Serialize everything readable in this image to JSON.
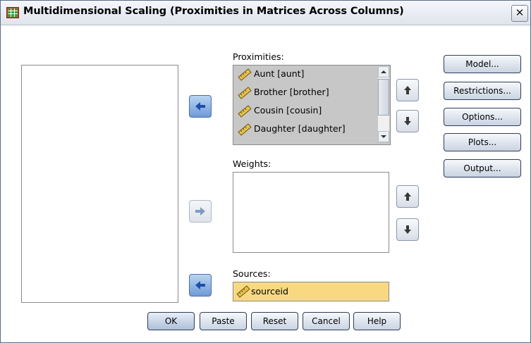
{
  "window": {
    "title": "Multidimensional Scaling (Proximities in Matrices Across Columns)",
    "close_symbol": "✕"
  },
  "proximities": {
    "label": "Proximities:",
    "items": [
      {
        "label": "Aunt [aunt]",
        "icon": "ruler-icon"
      },
      {
        "label": "Brother [brother]",
        "icon": "ruler-icon"
      },
      {
        "label": "Cousin [cousin]",
        "icon": "ruler-icon"
      },
      {
        "label": "Daughter [daughter]",
        "icon": "ruler-icon"
      }
    ]
  },
  "weights": {
    "label": "Weights:"
  },
  "sources": {
    "label": "Sources:",
    "value": "sourceid"
  },
  "side_buttons": {
    "model": "Model...",
    "restrictions": "Restrictions...",
    "options": "Options...",
    "plots": "Plots...",
    "output": "Output..."
  },
  "bottom_buttons": {
    "ok": "OK",
    "paste": "Paste",
    "reset": "Reset",
    "cancel": "Cancel",
    "help": "Help"
  },
  "colors": {
    "sources_highlight": "#f8d982",
    "list_selected_bg": "#c7c7c7",
    "arrow_blue": "#2f66c4"
  }
}
